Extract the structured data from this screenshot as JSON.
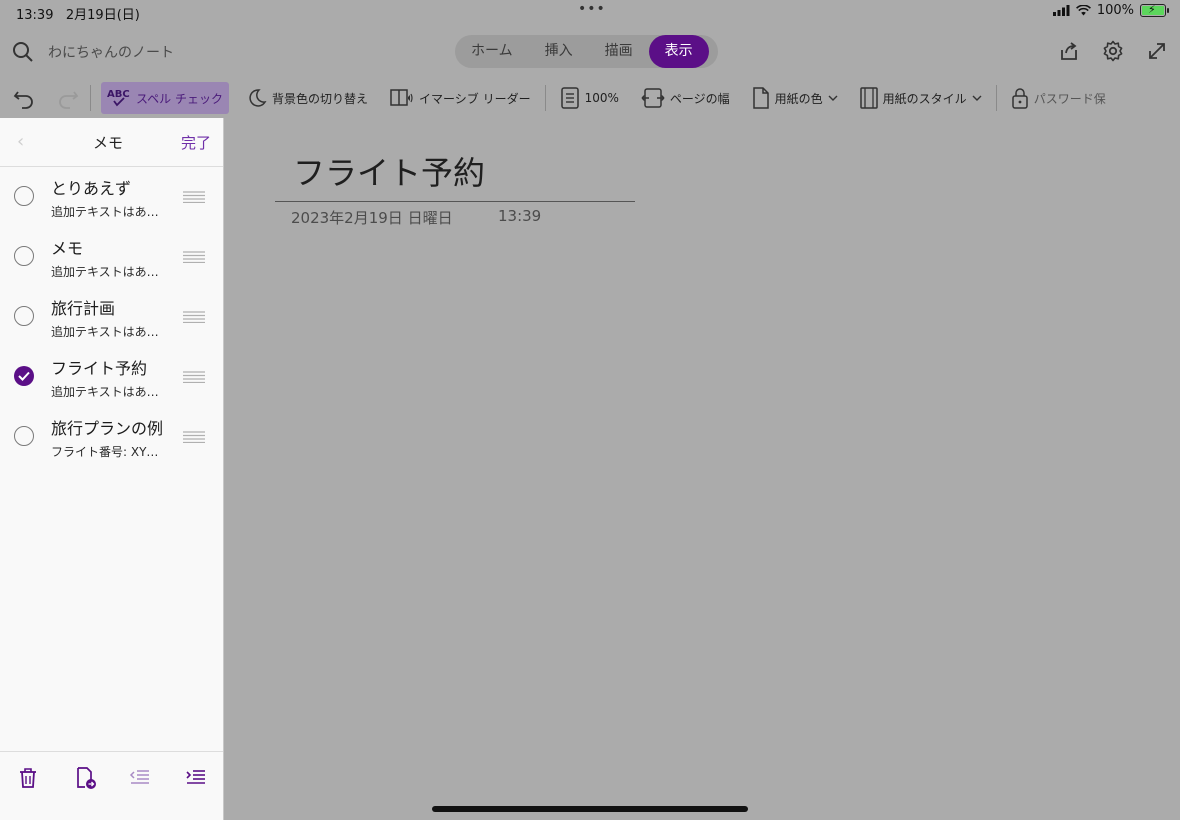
{
  "status": {
    "time": "13:39",
    "date": "2月19日(日)",
    "battery": "100%"
  },
  "header": {
    "notebook": "わにちゃんのノート",
    "tabs": [
      {
        "label": "ホーム"
      },
      {
        "label": "挿入"
      },
      {
        "label": "描画"
      },
      {
        "label": "表示"
      }
    ],
    "active_tab": "表示"
  },
  "ribbon": {
    "spell_check": "スペル チェック",
    "bg_toggle": "背景色の切り替え",
    "immersive_reader": "イマーシブ リーダー",
    "zoom": "100%",
    "page_width": "ページの幅",
    "paper_color": "用紙の色",
    "paper_style": "用紙のスタイル",
    "password": "パスワード保"
  },
  "panel": {
    "title": "メモ",
    "done": "完了",
    "items": [
      {
        "title": "とりあえず",
        "sub": "追加テキストはあ…",
        "checked": false
      },
      {
        "title": "メモ",
        "sub": "追加テキストはあ…",
        "checked": false
      },
      {
        "title": "旅行計画",
        "sub": "追加テキストはあ…",
        "checked": false
      },
      {
        "title": "フライト予約",
        "sub": "追加テキストはあ…",
        "checked": true
      },
      {
        "title": "旅行プランの例",
        "sub": "フライト番号: XY…",
        "checked": false
      }
    ]
  },
  "page": {
    "title": "フライト予約",
    "date": "2023年2月19日 日曜日",
    "time": "13:39"
  },
  "colors": {
    "accent": "#5b0f87",
    "link": "#6f2fa8",
    "canvas": "#ababab"
  }
}
